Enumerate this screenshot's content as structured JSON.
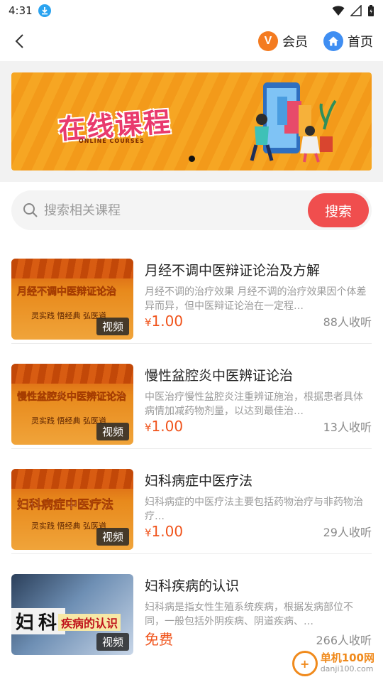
{
  "status_bar": {
    "time": "4:31"
  },
  "nav": {
    "vip_label": "会员",
    "home_label": "首页"
  },
  "banner": {
    "title": "在线课程",
    "subtitle": "ONLINE COURSES"
  },
  "search": {
    "placeholder": "搜索相关课程",
    "button_label": "搜索"
  },
  "courses": [
    {
      "thumb_title": "月经不调中医辩证论治",
      "thumb_slogan": "灵实践 悟经典 弘医道",
      "tag": "视频",
      "title": "月经不调中医辩证论治及方解",
      "desc": "月经不调的治疗效果 月经不调的治疗效果因个体差异而异，但中医辩证论治在一定程…",
      "currency": "¥",
      "price": "1.00",
      "students": "88人收听"
    },
    {
      "thumb_title": "慢性盆腔炎中医辨证论治",
      "thumb_slogan": "灵实践 悟经典 弘医道",
      "tag": "视频",
      "title": "慢性盆腔炎中医辨证论治",
      "desc": "中医治疗慢性盆腔炎注重辨证施治，根据患者具体病情加减药物剂量，以达到最佳治…",
      "currency": "¥",
      "price": "1.00",
      "students": "13人收听"
    },
    {
      "thumb_title": "妇科病症中医疗法",
      "thumb_slogan": "灵实践 悟经典 弘医道",
      "tag": "视频",
      "title": "妇科病症中医疗法",
      "desc": "妇科病症的中医疗法主要包括药物治疗与非药物治疗…",
      "currency": "¥",
      "price": "1.00",
      "students": "29人收听"
    },
    {
      "thumb_big": "妇科",
      "thumb_red": "疾病的认识",
      "tag": "视频",
      "title": "妇科疾病的认识",
      "desc": "妇科病是指女性生殖系统疾病，根据发病部位不同，一般包括外阴疾病、阴道疾病、…",
      "price_free": "免费",
      "students": "266人收听"
    }
  ],
  "watermark": {
    "name": "单机100网",
    "url": "danji100.com"
  },
  "colors": {
    "accent": "#f04e4e",
    "price": "#f0541c",
    "vip": "#f47b20",
    "home": "#3f8ef2"
  }
}
